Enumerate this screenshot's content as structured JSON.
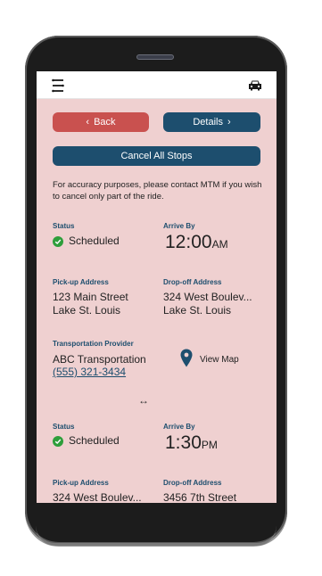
{
  "header": {
    "menu_icon": "menu-icon",
    "car_icon": "car-icon"
  },
  "nav": {
    "back_label": "Back",
    "details_label": "Details",
    "cancel_all_label": "Cancel All Stops"
  },
  "note": "For accuracy purposes, please contact MTM if you wish to cancel only part of the ride.",
  "trips": [
    {
      "status_label": "Status",
      "status": "Scheduled",
      "arrive_label": "Arrive By",
      "arrive_time": "12:00",
      "arrive_ampm": "AM",
      "pickup_label": "Pick-up Address",
      "pickup_line1": "123 Main Street",
      "pickup_line2": "Lake St. Louis",
      "dropoff_label": "Drop-off Address",
      "dropoff_line1": "324 West Boulev...",
      "dropoff_line2": "Lake St. Louis",
      "provider_label": "Transportation Provider",
      "provider_name": "ABC Transportation",
      "provider_phone": "(555) 321-3434",
      "view_map_label": "View Map"
    },
    {
      "status_label": "Status",
      "status": "Scheduled",
      "arrive_label": "Arrive By",
      "arrive_time": "1:30",
      "arrive_ampm": "PM",
      "pickup_label": "Pick-up Address",
      "pickup_line1": "324 West Boulev...",
      "dropoff_label": "Drop-off Address",
      "dropoff_line1": "3456 7th Street"
    }
  ],
  "separator": "↔",
  "colors": {
    "screen_bg": "#efd0d0",
    "back_button": "#c9514f",
    "primary": "#1d4e6e",
    "status_green": "#2e9e3b",
    "phone_body": "#1c1c1c"
  }
}
